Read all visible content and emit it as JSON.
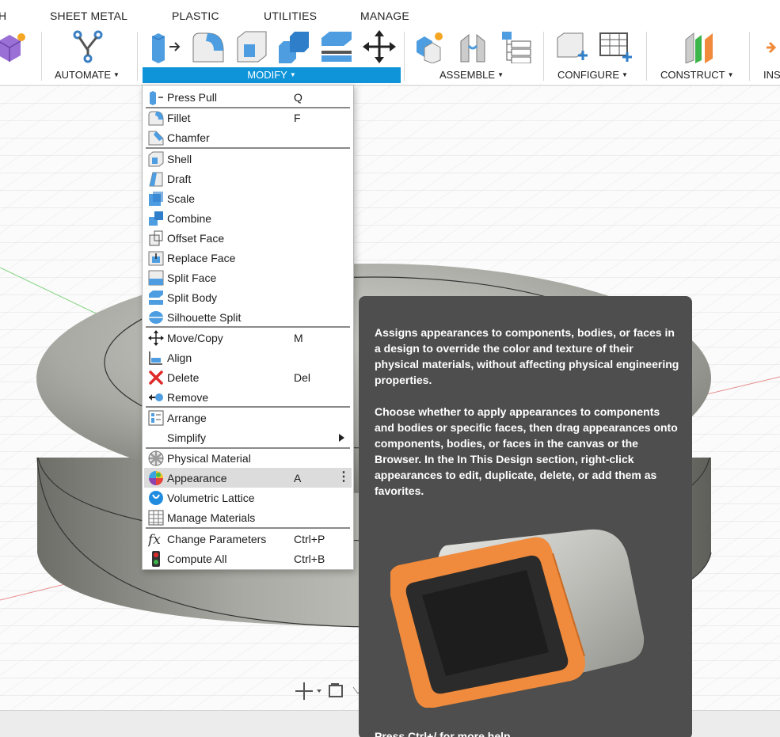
{
  "toolbar": {
    "tabs": [
      "H",
      "SHEET METAL",
      "PLASTIC",
      "UTILITIES",
      "MANAGE"
    ],
    "groups": {
      "automate": "AUTOMATE",
      "modify": "MODIFY",
      "assemble": "ASSEMBLE",
      "configure": "CONFIGURE",
      "construct": "CONSTRUCT",
      "insert": "INS"
    },
    "accent_color": "#0f94d9"
  },
  "menu": {
    "items": [
      {
        "label": "Press Pull",
        "shortcut": "Q",
        "icon": "press-pull-icon"
      },
      {
        "label": "Fillet",
        "shortcut": "F",
        "icon": "fillet-icon"
      },
      {
        "label": "Chamfer",
        "shortcut": "",
        "icon": "chamfer-icon"
      },
      {
        "label": "Shell",
        "shortcut": "",
        "icon": "shell-icon"
      },
      {
        "label": "Draft",
        "shortcut": "",
        "icon": "draft-icon"
      },
      {
        "label": "Scale",
        "shortcut": "",
        "icon": "scale-icon"
      },
      {
        "label": "Combine",
        "shortcut": "",
        "icon": "combine-icon"
      },
      {
        "label": "Offset Face",
        "shortcut": "",
        "icon": "offset-face-icon"
      },
      {
        "label": "Replace Face",
        "shortcut": "",
        "icon": "replace-face-icon"
      },
      {
        "label": "Split Face",
        "shortcut": "",
        "icon": "split-face-icon"
      },
      {
        "label": "Split Body",
        "shortcut": "",
        "icon": "split-body-icon"
      },
      {
        "label": "Silhouette Split",
        "shortcut": "",
        "icon": "silhouette-split-icon"
      },
      {
        "label": "Move/Copy",
        "shortcut": "M",
        "icon": "move-copy-icon"
      },
      {
        "label": "Align",
        "shortcut": "",
        "icon": "align-icon"
      },
      {
        "label": "Delete",
        "shortcut": "Del",
        "icon": "delete-icon"
      },
      {
        "label": "Remove",
        "shortcut": "",
        "icon": "remove-icon"
      },
      {
        "label": "Arrange",
        "shortcut": "",
        "icon": "arrange-icon"
      },
      {
        "label": "Simplify",
        "shortcut": "",
        "icon": "simplify-submenu-arrow"
      },
      {
        "label": "Physical Material",
        "shortcut": "",
        "icon": "physical-material-icon"
      },
      {
        "label": "Appearance",
        "shortcut": "A",
        "icon": "appearance-icon"
      },
      {
        "label": "Volumetric Lattice",
        "shortcut": "",
        "icon": "volumetric-lattice-icon"
      },
      {
        "label": "Manage Materials",
        "shortcut": "",
        "icon": "manage-materials-icon"
      },
      {
        "label": "Change Parameters",
        "shortcut": "Ctrl+P",
        "icon": "fx-icon"
      },
      {
        "label": "Compute All",
        "shortcut": "Ctrl+B",
        "icon": "compute-all-icon"
      }
    ]
  },
  "tooltip": {
    "paragraph1": "Assigns appearances to components, bodies, or faces in a design to override the color and texture of their physical materials, without affecting physical engineering properties.",
    "paragraph2": "Choose whether to apply appearances to components and bodies or specific faces, then drag appearances onto components, bodies, or faces in the canvas or the Browser. In the In This Design section, right-click appearances to edit, duplicate, delete, or add them as favorites.",
    "footer": "Press Ctrl+/ for more help."
  }
}
